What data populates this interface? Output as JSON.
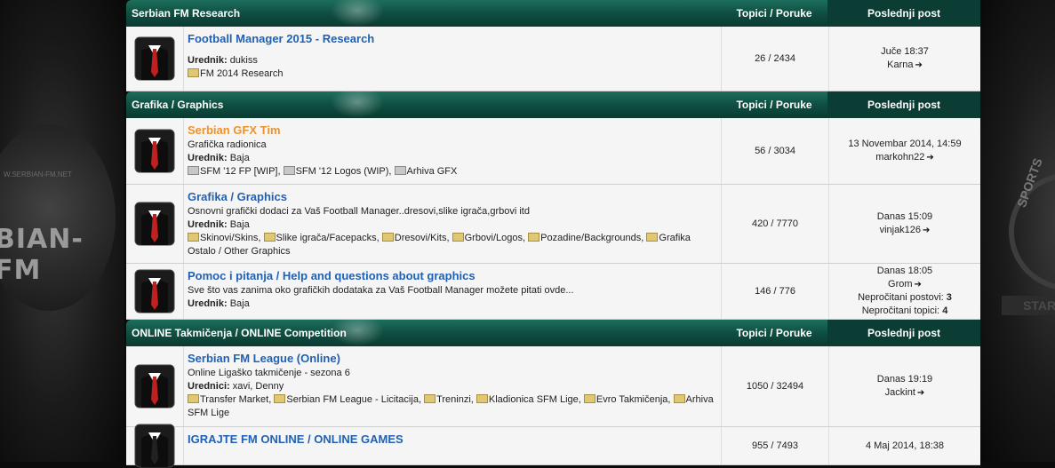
{
  "sections": [
    {
      "title": "Serbian FM Research",
      "col_topics": "Topici / Poruke",
      "col_last": "Poslednji post",
      "forums": [
        {
          "title": "Football Manager 2015 - Research",
          "description": "",
          "moderator_label": "Urednik:",
          "moderators": "dukiss",
          "subforums": [
            "FM 2014 Research"
          ],
          "stats": "26 / 2434",
          "last_lines": [
            "Juče 18:37",
            "Karna"
          ]
        }
      ]
    },
    {
      "title": "Grafika / Graphics",
      "col_topics": "Topici / Poruke",
      "col_last": "Poslednji post",
      "forums": [
        {
          "title": "Serbian GFX Tim",
          "description": "Grafička radionica",
          "moderator_label": "Urednik:",
          "moderators": "Baja",
          "subforums": [
            "SFM '12 FP [WIP]",
            "SFM '12 Logos (WIP)",
            "Arhiva GFX"
          ],
          "stats": "56 / 3034",
          "last_lines": [
            "13 Novembar 2014, 14:59",
            "markohn22"
          ]
        },
        {
          "title": "Grafika / Graphics",
          "description": "Osnovni grafički dodaci za Vaš Football Manager..dresovi,slike igrača,grbovi itd",
          "moderator_label": "Urednik:",
          "moderators": "Baja",
          "subforums": [
            "Skinovi/Skins",
            "Slike igrača/Facepacks",
            "Dresovi/Kits",
            "Grbovi/Logos",
            "Pozadine/Backgrounds",
            "Grafika Ostalo / Other Graphics"
          ],
          "stats": "420 / 7770",
          "last_lines": [
            "Danas 15:09",
            "vinjak126"
          ]
        },
        {
          "title": "Pomoc i pitanja / Help and questions about graphics",
          "description": "Sve što vas zanima oko grafičkih dodataka za Vaš Football Manager možete pitati ovde...",
          "moderator_label": "Urednik:",
          "moderators": "Baja",
          "subforums": [],
          "stats": "146 / 776",
          "last_lines": [
            "Danas 18:05",
            "Grom"
          ],
          "unread_posts_label": "Nepročitani postovi:",
          "unread_posts": "3",
          "unread_topics_label": "Nepročitani topici:",
          "unread_topics": "4"
        }
      ]
    },
    {
      "title": "ONLINE Takmičenja / ONLINE Competition",
      "col_topics": "Topici / Poruke",
      "col_last": "Poslednji post",
      "forums": [
        {
          "title": "Serbian FM League (Online)",
          "description": "Online Ligaško takmičenje - sezona 6",
          "moderator_label": "Urednici:",
          "moderators": "xavi, Denny",
          "subforums": [
            "Transfer Market",
            "Serbian FM League - Licitacija",
            "Treninzi",
            "Kladionica SFM Lige",
            "Evro Takmičenja",
            "Arhiva SFM Lige"
          ],
          "stats": "1050 / 32494",
          "last_lines": [
            "Danas 19:19",
            "Jackint"
          ]
        },
        {
          "title": "IGRAJTE FM ONLINE / ONLINE GAMES",
          "description": "",
          "moderator_label": "",
          "moderators": "",
          "subforums": [],
          "stats": "955 / 7493",
          "last_lines": [
            "4 Maj 2014, 18:38",
            ""
          ]
        }
      ]
    }
  ],
  "background": {
    "left_brand": "BIAN-FM",
    "left_url": "W.SERBIAN-FM.NET",
    "right_text": "SPORTS",
    "right_banner": "STAR"
  }
}
